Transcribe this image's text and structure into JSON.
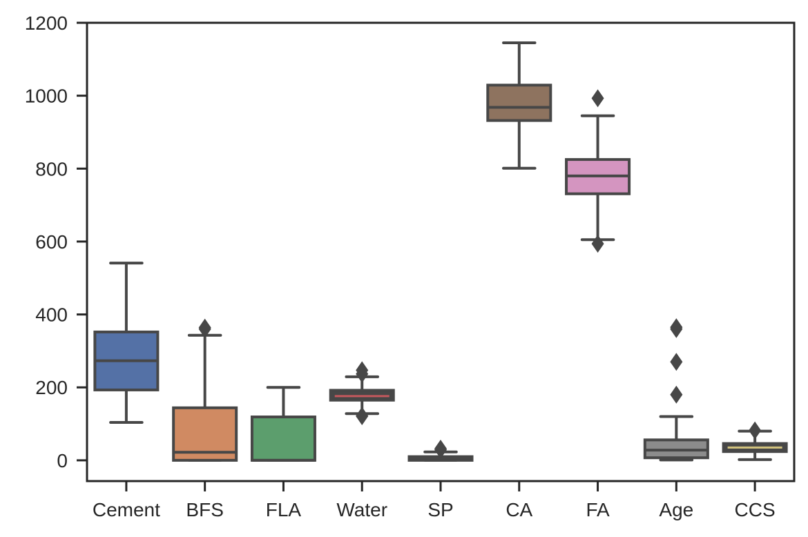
{
  "chart_data": {
    "type": "box",
    "title": "",
    "xlabel": "",
    "ylabel": "",
    "ylim": [
      -57,
      1200
    ],
    "yticks": [
      0,
      200,
      400,
      600,
      800,
      1000,
      1200
    ],
    "grid": false,
    "categories": [
      "Cement",
      "BFS",
      "FLA",
      "Water",
      "SP",
      "CA",
      "FA",
      "Age",
      "CCS"
    ],
    "boxes": [
      {
        "name": "Cement",
        "color": "#5471a6",
        "median_color": "#474747",
        "whisker_low": 104,
        "q1": 193,
        "median": 273,
        "q3": 352,
        "whisker_high": 541,
        "outliers": []
      },
      {
        "name": "BFS",
        "color": "#d08a62",
        "median_color": "#474747",
        "whisker_low": 0,
        "q1": 0,
        "median": 22,
        "q3": 144,
        "whisker_high": 343,
        "outliers": [
          360,
          364
        ]
      },
      {
        "name": "FLA",
        "color": "#5c9e6d",
        "median_color": "#474747",
        "whisker_low": 0,
        "q1": 0,
        "median": 0,
        "q3": 119,
        "whisker_high": 200,
        "outliers": []
      },
      {
        "name": "Water",
        "color": "#474747",
        "median_color": "#c4585d",
        "whisker_low": 128,
        "q1": 165,
        "median": 176,
        "q3": 192,
        "whisker_high": 229,
        "outliers": [
          122,
          121,
          237,
          247
        ]
      },
      {
        "name": "SP",
        "color": "#474747",
        "median_color": "#474747",
        "whisker_low": 0,
        "q1": 0,
        "median": 6,
        "q3": 10,
        "whisker_high": 23,
        "outliers": [
          29,
          32
        ]
      },
      {
        "name": "CA",
        "color": "#8e735f",
        "median_color": "#474747",
        "whisker_low": 801,
        "q1": 932,
        "median": 968,
        "q3": 1029,
        "whisker_high": 1145,
        "outliers": []
      },
      {
        "name": "FA",
        "color": "#d495c0",
        "median_color": "#474747",
        "whisker_low": 605,
        "q1": 731,
        "median": 780,
        "q3": 825,
        "whisker_high": 945,
        "outliers": [
          594,
          993
        ]
      },
      {
        "name": "Age",
        "color": "#8c8c8c",
        "median_color": "#474747",
        "whisker_low": 1,
        "q1": 7,
        "median": 28,
        "q3": 56,
        "whisker_high": 120,
        "outliers": [
          180,
          270,
          360,
          365
        ]
      },
      {
        "name": "CCS",
        "color": "#474747",
        "median_color": "#d3c47e",
        "whisker_low": 2,
        "q1": 24,
        "median": 35,
        "q3": 46,
        "whisker_high": 80,
        "outliers": [
          82
        ]
      }
    ]
  },
  "style": {
    "line_color": "#474747",
    "axis_color": "#262626"
  }
}
